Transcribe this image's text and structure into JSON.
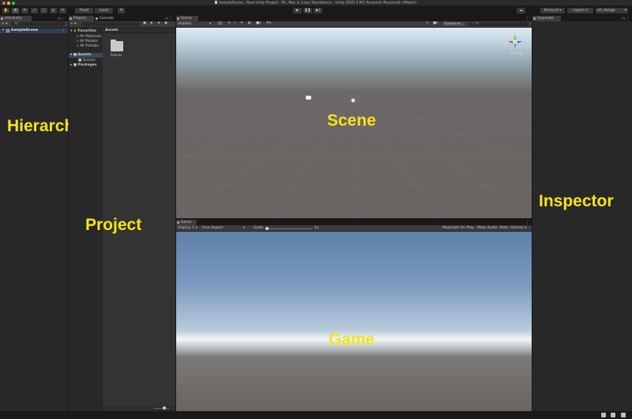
{
  "window": {
    "title": "SampleScene - New Unity Project - PC, Mac & Linux Standalone - Unity 2020.3.0f1 Personal (Personal) <Metal>",
    "traffic_colors": [
      "#fe5f57",
      "#febc2e",
      "#28c840"
    ]
  },
  "toolbar": {
    "pivot_label": "Pivot",
    "local_label": "Local",
    "account_label": "Account",
    "layers_label": "Layers",
    "layout_label": "ah_design"
  },
  "hierarchy": {
    "tab_label": "Hierarchy",
    "search_placeholder": "All",
    "scene_item": "SampleScene",
    "overlay_label": "Hierarchy"
  },
  "project": {
    "tabs": [
      "Project",
      "Console"
    ],
    "favorites_label": "Favorites",
    "favorites_items": [
      "All Materials",
      "All Models",
      "All Prefabs"
    ],
    "assets_label": "Assets",
    "assets_children": [
      "Scenes"
    ],
    "packages_label": "Packages",
    "breadcrumb": "Assets",
    "folder_label": "Scenes",
    "overlay_label": "Project"
  },
  "scene": {
    "tab_label": "Scene",
    "shading_mode": "Shaded",
    "mode_2d": "2D",
    "gizmos_label": "Gizmos",
    "persp_label": "< Persp",
    "overlay_label": "Scene"
  },
  "game": {
    "tab_label": "Game",
    "display": "Display 1",
    "aspect": "Free Aspect",
    "scale_label": "Scale",
    "scale_value": "1x",
    "maximize_label": "Maximize On Play",
    "mute_label": "Mute Audio",
    "stats_label": "Stats",
    "gizmos_label": "Gizmos",
    "overlay_label": "Game"
  },
  "inspector": {
    "tab_label": "Inspector",
    "overlay_label": "Inspector"
  }
}
